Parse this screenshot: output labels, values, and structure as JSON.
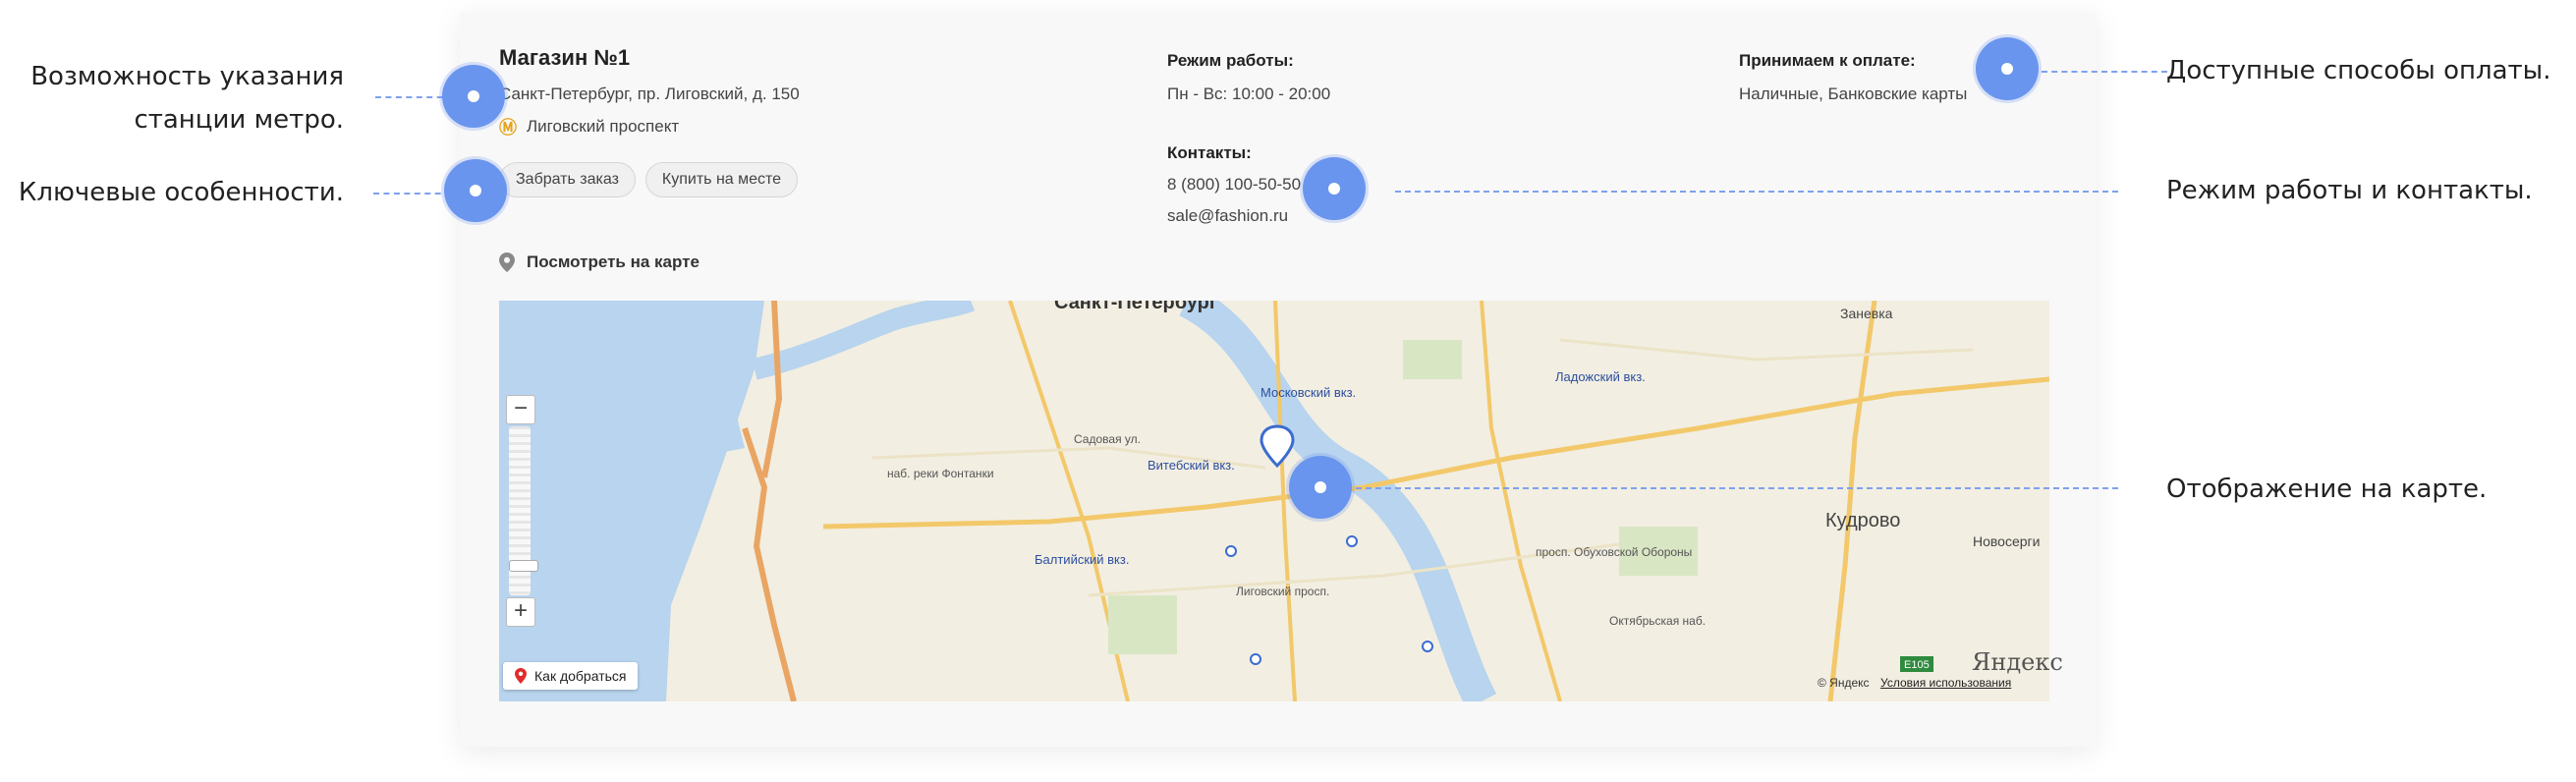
{
  "store": {
    "title": "Магазин №1",
    "address": "Санкт-Петербург, пр. Лиговский, д. 150",
    "metro_station": "Лиговский проспект",
    "metro_icon": "metro-m-icon",
    "chips": [
      "Забрать заказ",
      "Купить на месте"
    ]
  },
  "schedule": {
    "heading": "Режим работы:",
    "hours": "Пн - Вс: 10:00 - 20:00"
  },
  "contacts": {
    "heading": "Контакты:",
    "phone": "8 (800) 100-50-50",
    "email": "sale@fashion.ru"
  },
  "payment": {
    "heading": "Принимаем к оплате:",
    "methods": "Наличные, Банковские карты"
  },
  "map": {
    "link_label": "Посмотреть на карте",
    "route_label": "Как добраться",
    "logo": "Яндекс",
    "copyright": "© Яндекс",
    "terms": "Условия использования",
    "zoom_in": "+",
    "zoom_out": "−",
    "places": {
      "spb": "Санкт-Петербург",
      "zanevka": "Заневка",
      "ladozhsky": "Ладожский вкз.",
      "moskovsky": "Московский вкз.",
      "vitebsky": "Витебский вкз.",
      "baltiysky": "Балтийский вкз.",
      "kudrovo": "Кудрово",
      "novosergi": "Новосерги",
      "nab_fontanki": "наб. реки Фонтанки",
      "sadovaya": "Садовая ул.",
      "ligovsky": "Лиговский просп.",
      "obukhovskoy": "просп. Обуховской Обороны",
      "oktyabrskaya": "Октябрьская наб.",
      "e105": "E105"
    }
  },
  "annotations": {
    "metro": "Возможность указания\nстанции метро.",
    "features": "Ключевые особенности.",
    "payment": "Доступные способы оплаты.",
    "schedule_contacts": "Режим работы и контакты.",
    "map": "Отображение на карте."
  },
  "colors": {
    "accent": "#6a95ee",
    "metro": "#e6a31c",
    "water": "#b8d4ee",
    "road": "#f3c86a"
  }
}
